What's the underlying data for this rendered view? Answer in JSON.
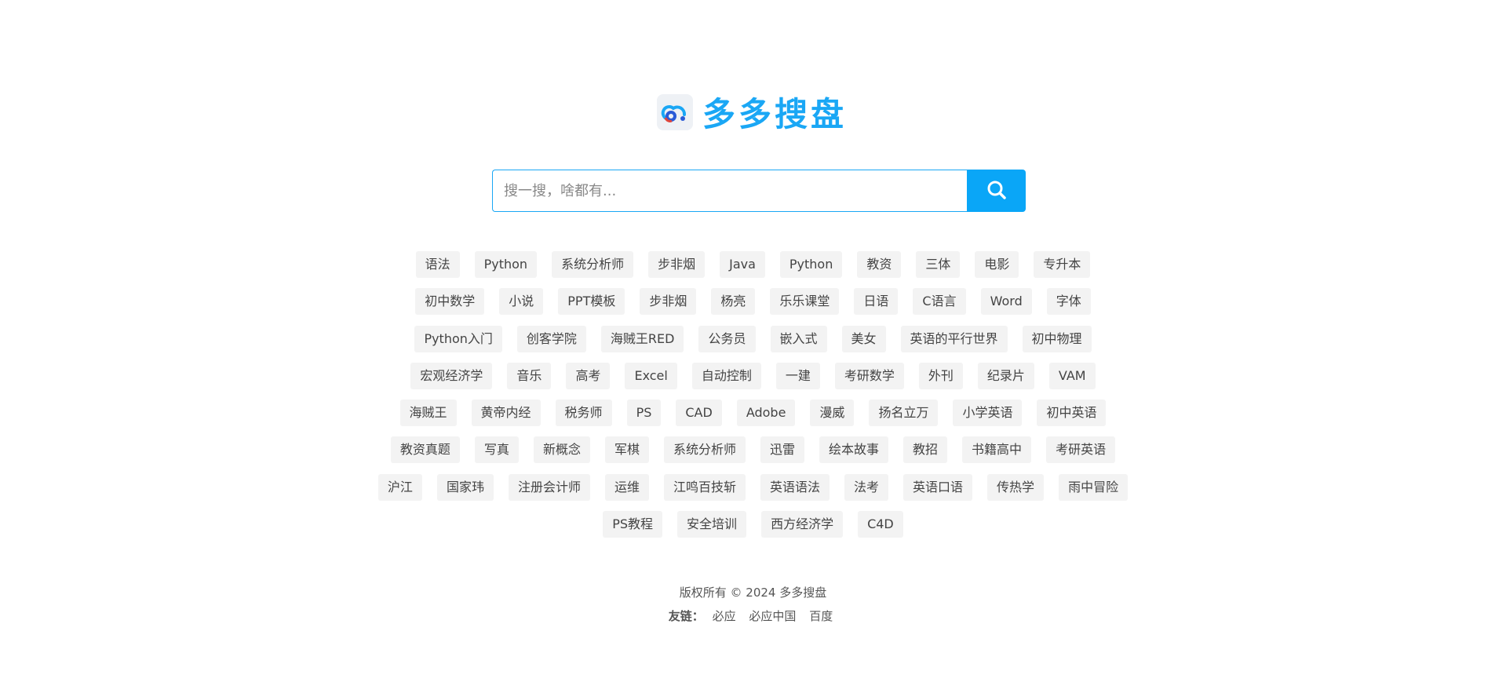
{
  "logo": {
    "text": "多多搜盘",
    "icon": "cloud-disk-logo-icon"
  },
  "search": {
    "placeholder": "搜一搜，啥都有...",
    "value": "",
    "button_icon": "search-icon"
  },
  "tag_rows": [
    [
      "语法",
      "Python",
      "系统分析师",
      "步非烟",
      "Java",
      "Python",
      "教资",
      "三体",
      "电影",
      "专升本"
    ],
    [
      "初中数学",
      "小说",
      "PPT模板",
      "步非烟",
      "杨亮",
      "乐乐课堂",
      "日语",
      "C语言",
      "Word",
      "字体"
    ],
    [
      "Python入门",
      "创客学院",
      "海贼王RED",
      "公务员",
      "嵌入式",
      "美女",
      "英语的平行世界",
      "初中物理"
    ],
    [
      "宏观经济学",
      "音乐",
      "高考",
      "Excel",
      "自动控制",
      "一建",
      "考研数学",
      "外刊",
      "纪录片",
      "VAM"
    ],
    [
      "海贼王",
      "黄帝内经",
      "税务师",
      "PS",
      "CAD",
      "Adobe",
      "漫威",
      "扬名立万",
      "小学英语",
      "初中英语"
    ],
    [
      "教资真题",
      "写真",
      "新概念",
      "军棋",
      "系统分析师",
      "迅雷",
      "绘本故事",
      "教招",
      "书籍高中",
      "考研英语"
    ],
    [
      "沪江",
      "国家玮",
      "注册会计师",
      "运维",
      "江鸣百技斩",
      "英语语法",
      "法考",
      "英语口语",
      "传热学",
      "雨中冒险"
    ],
    [
      "PS教程",
      "安全培训",
      "西方经济学",
      "C4D"
    ]
  ],
  "footer": {
    "copyright": "版权所有 © 2024 多多搜盘",
    "links_label": "友链：",
    "links": [
      "必应",
      "必应中国",
      "百度"
    ]
  },
  "colors": {
    "accent": "#0aa6f7",
    "tag_bg": "#f3f3f3"
  }
}
